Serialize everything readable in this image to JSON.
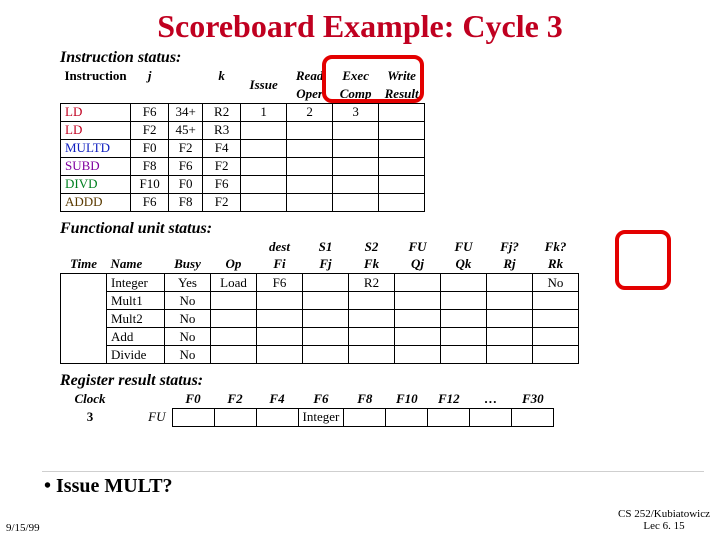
{
  "title": "Scoreboard Example: Cycle 3",
  "sections": {
    "instr_status": "Instruction status:",
    "fu_status": "Functional unit status:",
    "reg_status": "Register result status:"
  },
  "instr_headers": {
    "instruction": "Instruction",
    "j": "j",
    "k": "k",
    "issue": "Issue",
    "read": "Read",
    "oper": "Oper",
    "exec": "Exec",
    "comp": "Comp",
    "write": "Write",
    "result": "Result"
  },
  "instructions": [
    {
      "name": "LD",
      "color": "c-red",
      "j": "F6",
      "jextra": "34+",
      "k": "R2",
      "issue": "1",
      "read": "2",
      "exec": "3",
      "write": ""
    },
    {
      "name": "LD",
      "color": "c-red",
      "j": "F2",
      "jextra": "45+",
      "k": "R3",
      "issue": "",
      "read": "",
      "exec": "",
      "write": ""
    },
    {
      "name": "MULTD",
      "color": "c-blue",
      "j": "F0",
      "jextra": "F2",
      "k": "F4",
      "issue": "",
      "read": "",
      "exec": "",
      "write": ""
    },
    {
      "name": "SUBD",
      "color": "c-purple",
      "j": "F8",
      "jextra": "F6",
      "k": "F2",
      "issue": "",
      "read": "",
      "exec": "",
      "write": ""
    },
    {
      "name": "DIVD",
      "color": "c-green",
      "j": "F10",
      "jextra": "F0",
      "k": "F6",
      "issue": "",
      "read": "",
      "exec": "",
      "write": ""
    },
    {
      "name": "ADDD",
      "color": "c-brown",
      "j": "F6",
      "jextra": "F8",
      "k": "F2",
      "issue": "",
      "read": "",
      "exec": "",
      "write": ""
    }
  ],
  "fu_headers": {
    "time": "Time",
    "name": "Name",
    "busy": "Busy",
    "op": "Op",
    "dest": "dest",
    "fi": "Fi",
    "s1": "S1",
    "fj": "Fj",
    "s2": "S2",
    "fk": "Fk",
    "fu1": "FU",
    "qj": "Qj",
    "fu2": "FU",
    "qk": "Qk",
    "fjq": "Fj?",
    "rj": "Rj",
    "fkq": "Fk?",
    "rk": "Rk"
  },
  "fu_rows": [
    {
      "name": "Integer",
      "busy": "Yes",
      "op": "Load",
      "fi": "F6",
      "fj": "",
      "fk": "R2",
      "qj": "",
      "qk": "",
      "rj": "",
      "rk": "No"
    },
    {
      "name": "Mult1",
      "busy": "No",
      "op": "",
      "fi": "",
      "fj": "",
      "fk": "",
      "qj": "",
      "qk": "",
      "rj": "",
      "rk": ""
    },
    {
      "name": "Mult2",
      "busy": "No",
      "op": "",
      "fi": "",
      "fj": "",
      "fk": "",
      "qj": "",
      "qk": "",
      "rj": "",
      "rk": ""
    },
    {
      "name": "Add",
      "busy": "No",
      "op": "",
      "fi": "",
      "fj": "",
      "fk": "",
      "qj": "",
      "qk": "",
      "rj": "",
      "rk": ""
    },
    {
      "name": "Divide",
      "busy": "No",
      "op": "",
      "fi": "",
      "fj": "",
      "fk": "",
      "qj": "",
      "qk": "",
      "rj": "",
      "rk": ""
    }
  ],
  "reg_headers": {
    "clock": "Clock",
    "fu": "FU",
    "f0": "F0",
    "f2": "F2",
    "f4": "F4",
    "f6": "F6",
    "f8": "F8",
    "f10": "F10",
    "f12": "F12",
    "dots": "…",
    "f30": "F30"
  },
  "reg_row": {
    "clock": "3",
    "f0": "",
    "f2": "",
    "f4": "",
    "f6": "Integer",
    "f8": "",
    "f10": "",
    "f12": "",
    "dots": "",
    "f30": ""
  },
  "bullet": "Issue MULT?",
  "date": "9/15/99",
  "footer_line1": "CS 252/Kubiatowicz",
  "footer_line2": "Lec 6. 15"
}
